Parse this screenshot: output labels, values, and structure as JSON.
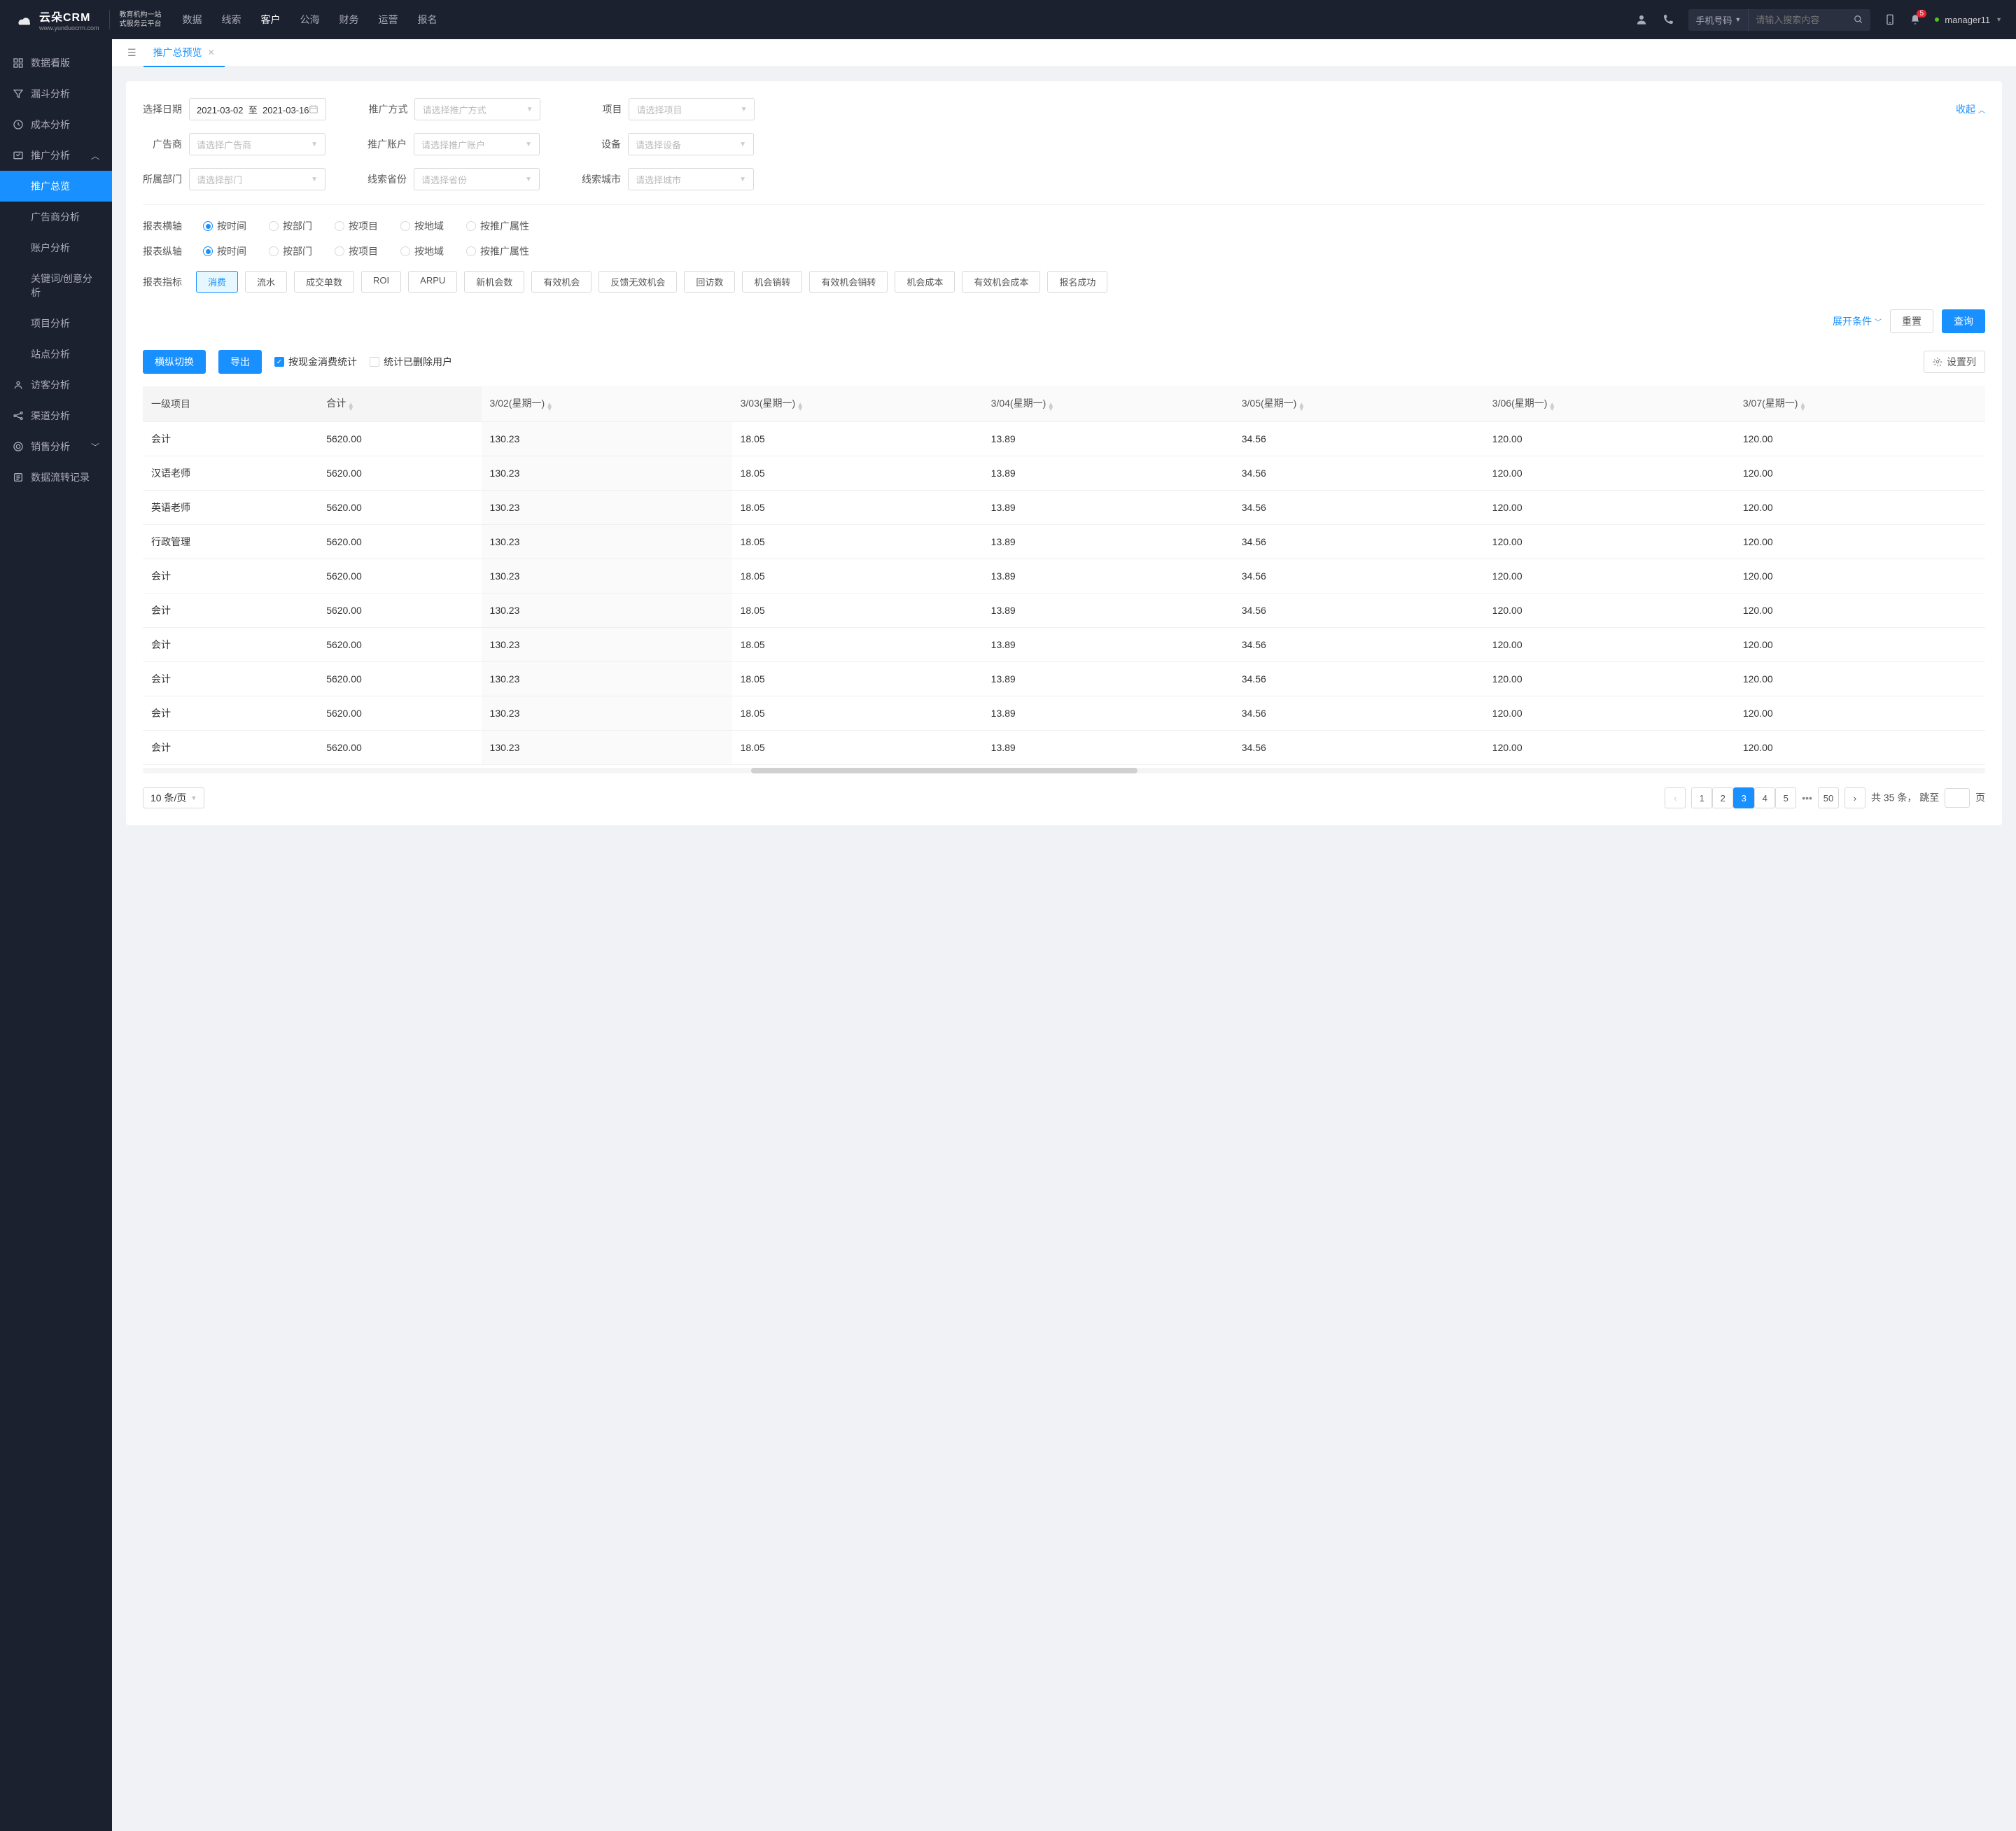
{
  "header": {
    "logo_main": "云朵CRM",
    "logo_sub": "www.yunduocrm.com",
    "logo_desc1": "教育机构一站",
    "logo_desc2": "式服务云平台",
    "nav": [
      "数据",
      "线索",
      "客户",
      "公海",
      "财务",
      "运营",
      "报名"
    ],
    "search_type": "手机号码",
    "search_placeholder": "请输入搜索内容",
    "badge_count": "5",
    "username": "manager11"
  },
  "sidebar": {
    "items": [
      {
        "icon": "dashboard",
        "label": "数据看版"
      },
      {
        "icon": "funnel",
        "label": "漏斗分析"
      },
      {
        "icon": "cost",
        "label": "成本分析"
      },
      {
        "icon": "promo",
        "label": "推广分析",
        "expanded": true,
        "children": [
          {
            "label": "推广总览",
            "active": true
          },
          {
            "label": "广告商分析"
          },
          {
            "label": "账户分析"
          },
          {
            "label": "关键词/创意分析"
          },
          {
            "label": "项目分析"
          },
          {
            "label": "站点分析"
          }
        ]
      },
      {
        "icon": "visitor",
        "label": "访客分析"
      },
      {
        "icon": "channel",
        "label": "渠道分析"
      },
      {
        "icon": "sales",
        "label": "销售分析",
        "expandable": true
      },
      {
        "icon": "flow",
        "label": "数据流转记录"
      }
    ]
  },
  "tab": {
    "label": "推广总预览"
  },
  "filters": {
    "date_label": "选择日期",
    "date_from": "2021-03-02",
    "date_sep": "至",
    "date_to": "2021-03-16",
    "method_label": "推广方式",
    "method_ph": "请选择推广方式",
    "project_label": "项目",
    "project_ph": "请选择项目",
    "advertiser_label": "广告商",
    "advertiser_ph": "请选择广告商",
    "account_label": "推广账户",
    "account_ph": "请选择推广账户",
    "device_label": "设备",
    "device_ph": "请选择设备",
    "dept_label": "所属部门",
    "dept_ph": "请选择部门",
    "province_label": "线索省份",
    "province_ph": "请选择省份",
    "city_label": "线索城市",
    "city_ph": "请选择城市",
    "collapse": "收起"
  },
  "axis": {
    "x_label": "报表横轴",
    "y_label": "报表纵轴",
    "options": [
      "按时间",
      "按部门",
      "按项目",
      "按地域",
      "按推广属性"
    ]
  },
  "metrics": {
    "label": "报表指标",
    "tags": [
      "消费",
      "流水",
      "成交单数",
      "ROI",
      "ARPU",
      "新机会数",
      "有效机会",
      "反馈无效机会",
      "回访数",
      "机会销转",
      "有效机会销转",
      "机会成本",
      "有效机会成本",
      "报名成功"
    ]
  },
  "actions": {
    "expand_cond": "展开条件",
    "reset": "重置",
    "query": "查询"
  },
  "toolbar": {
    "switch": "横纵切换",
    "export": "导出",
    "cb1": "按现金消费统计",
    "cb2": "统计已删除用户",
    "settings": "设置列"
  },
  "table": {
    "headers": [
      "一级项目",
      "合计",
      "3/02(星期一)",
      "3/03(星期一)",
      "3/04(星期一)",
      "3/05(星期一)",
      "3/06(星期一)",
      "3/07(星期一)"
    ],
    "rows": [
      [
        "会计",
        "5620.00",
        "130.23",
        "18.05",
        "13.89",
        "34.56",
        "120.00",
        "120.00"
      ],
      [
        "汉语老师",
        "5620.00",
        "130.23",
        "18.05",
        "13.89",
        "34.56",
        "120.00",
        "120.00"
      ],
      [
        "英语老师",
        "5620.00",
        "130.23",
        "18.05",
        "13.89",
        "34.56",
        "120.00",
        "120.00"
      ],
      [
        "行政管理",
        "5620.00",
        "130.23",
        "18.05",
        "13.89",
        "34.56",
        "120.00",
        "120.00"
      ],
      [
        "会计",
        "5620.00",
        "130.23",
        "18.05",
        "13.89",
        "34.56",
        "120.00",
        "120.00"
      ],
      [
        "会计",
        "5620.00",
        "130.23",
        "18.05",
        "13.89",
        "34.56",
        "120.00",
        "120.00"
      ],
      [
        "会计",
        "5620.00",
        "130.23",
        "18.05",
        "13.89",
        "34.56",
        "120.00",
        "120.00"
      ],
      [
        "会计",
        "5620.00",
        "130.23",
        "18.05",
        "13.89",
        "34.56",
        "120.00",
        "120.00"
      ],
      [
        "会计",
        "5620.00",
        "130.23",
        "18.05",
        "13.89",
        "34.56",
        "120.00",
        "120.00"
      ],
      [
        "会计",
        "5620.00",
        "130.23",
        "18.05",
        "13.89",
        "34.56",
        "120.00",
        "120.00"
      ]
    ]
  },
  "pagination": {
    "page_size": "10 条/页",
    "pages": [
      "1",
      "2",
      "3",
      "4",
      "5"
    ],
    "last_page": "50",
    "total_prefix": "共 35 条，",
    "jump_label": "跳至",
    "jump_suffix": "页"
  }
}
